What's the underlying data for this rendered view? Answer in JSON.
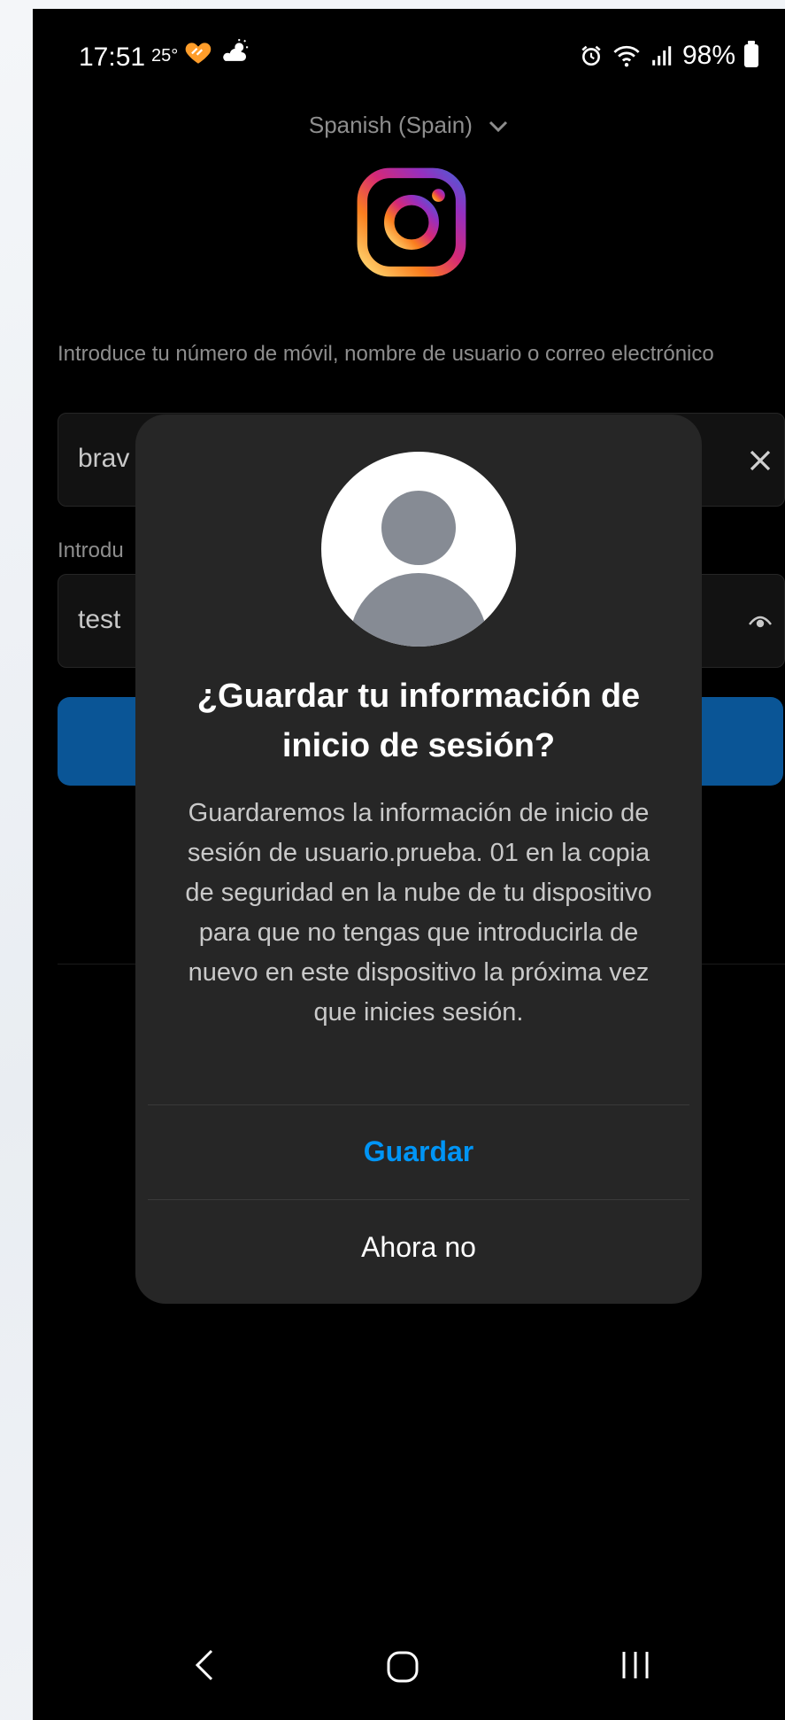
{
  "status_bar": {
    "time": "17:51",
    "temperature": "25°",
    "battery": "98%"
  },
  "language_selector": {
    "label": "Spanish (Spain)",
    "icon": "chevron-down-icon"
  },
  "login_form": {
    "username_label": "Introduce tu número de móvil, nombre de usuario o correo electrónico",
    "username_value": "brav",
    "password_label": "Introdu",
    "password_value": "test",
    "clear_icon": "close-icon",
    "visibility_icon": "eye-icon"
  },
  "dialog": {
    "title": "¿Guardar tu información de inicio de sesión?",
    "body": "Guardaremos la información de inicio de sesión de usuario.prueba. 01 en la copia de seguridad en la nube de tu dispositivo para que no tengas que introducirla de nuevo en este dispositivo la próxima vez que inicies sesión.",
    "primary_label": "Guardar",
    "secondary_label": "Ahora no"
  },
  "colors": {
    "background": "#000000",
    "dialog_bg": "#262626",
    "accent": "#0095f6",
    "login_button": "#0a5596"
  }
}
